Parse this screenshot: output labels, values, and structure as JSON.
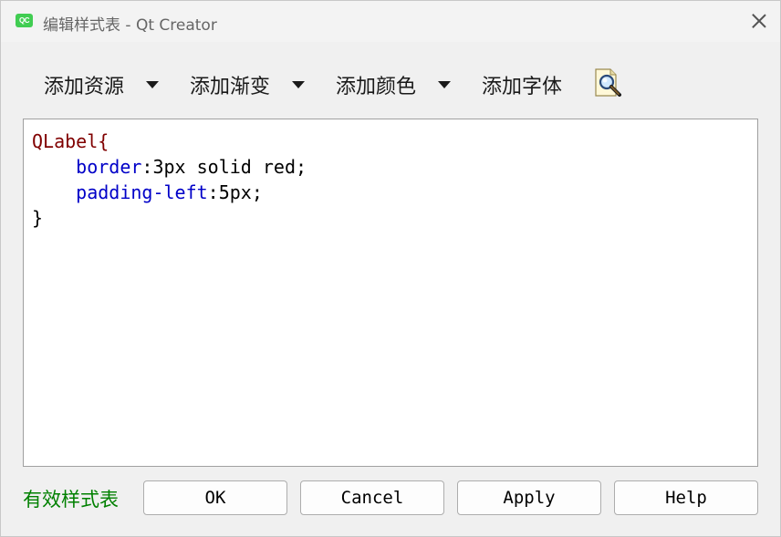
{
  "window": {
    "title": "编辑样式表 - Qt Creator",
    "app_icon_text": "QC"
  },
  "toolbar": {
    "add_resource": "添加资源",
    "add_gradient": "添加渐变",
    "add_color": "添加颜色",
    "add_font": "添加字体"
  },
  "editor": {
    "code_lines": [
      {
        "selector": "QLabel",
        "open": "{"
      },
      {
        "indent": "    ",
        "property": "border",
        "value": ":3px solid red;"
      },
      {
        "indent": "    ",
        "property": "padding-left",
        "value": ":5px;"
      },
      {
        "close": "}"
      }
    ]
  },
  "status": {
    "text": "有效样式表"
  },
  "buttons": {
    "ok": "OK",
    "cancel": "Cancel",
    "apply": "Apply",
    "help": "Help"
  },
  "colors": {
    "selector": "#800000",
    "property": "#0000c8",
    "valid_status": "#008000"
  }
}
